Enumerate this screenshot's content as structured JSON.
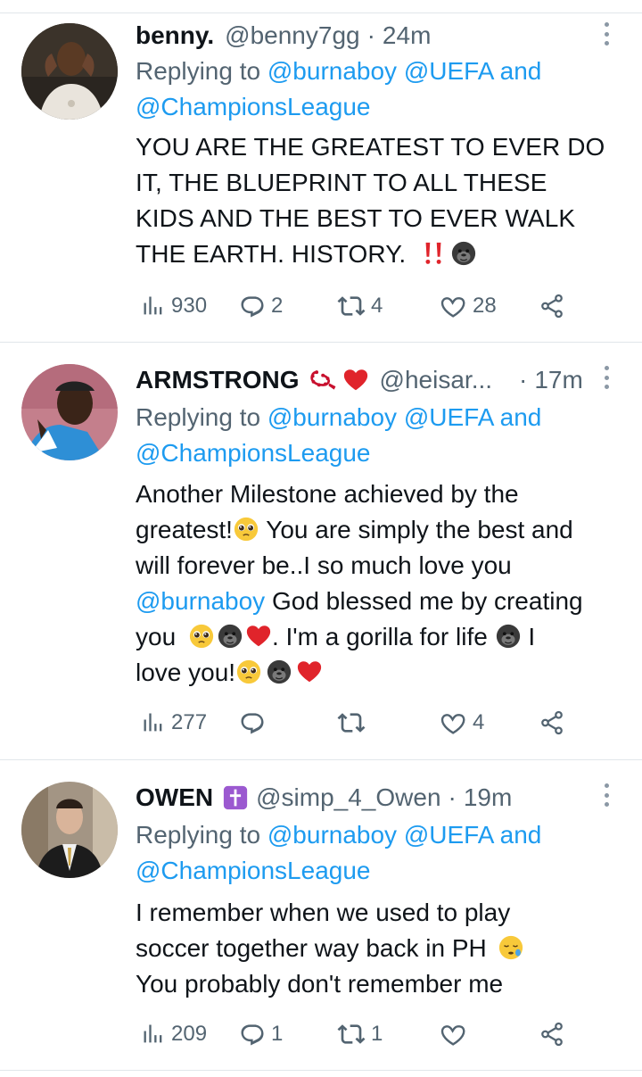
{
  "tweets": [
    {
      "name": "benny.",
      "handle": "@benny7gg",
      "dot": "·",
      "time": "24m",
      "reply_prefix": "Replying to ",
      "mentions": [
        "@burnaboy",
        "@UEFA",
        "@ChampionsLeague"
      ],
      "and": " and",
      "text_lines": [
        "YOU ARE THE GREATEST TO EVER DO",
        "IT, THE BLUEPRINT TO ALL THESE",
        "KIDS AND THE BEST TO EVER WALK",
        "THE EARTH. HISTORY. "
      ],
      "emojis": [
        "double-exclamation-icon",
        "gorilla-icon"
      ],
      "views": "930",
      "replies": "2",
      "retweets": "4",
      "likes": "28"
    },
    {
      "name": "ARMSTRONG",
      "name_badges": [
        "prayer-beads-icon",
        "red-heart-icon"
      ],
      "handle": "@heisar...",
      "dot": "·",
      "time": "17m",
      "reply_prefix": "Replying to ",
      "mentions": [
        "@burnaboy",
        "@UEFA",
        "@ChampionsLeague"
      ],
      "and": " and",
      "text_parts": {
        "a": "Another Milestone achieved by the",
        "b": "greatest!",
        "c": " You are simply the best and",
        "d": "will forever be..I so much love you",
        "e": "@burnaboy",
        "f": " God blessed me by creating",
        "g": "you ",
        "h": ". I'm a gorilla for life ",
        "i": " I",
        "j": "love you!"
      },
      "views": "277",
      "replies": "",
      "retweets": "",
      "likes": "4"
    },
    {
      "name": "OWEN",
      "name_badges": [
        "latin-cross-icon"
      ],
      "handle": "@simp_4_Owen",
      "dot": "·",
      "time": "19m",
      "reply_prefix": "Replying to ",
      "mentions": [
        "@burnaboy",
        "@UEFA",
        "@ChampionsLeague"
      ],
      "and": " and",
      "text_lines": [
        "I remember when we used to play",
        "soccer together way back in PH ",
        "You probably don't remember me"
      ],
      "emojis": [
        "sleepy-face-icon"
      ],
      "views": "209",
      "replies": "1",
      "retweets": "1",
      "likes": ""
    }
  ],
  "colors": {
    "link": "#1d9bf0",
    "secondary": "#536471",
    "divider": "#e1e6ea"
  }
}
